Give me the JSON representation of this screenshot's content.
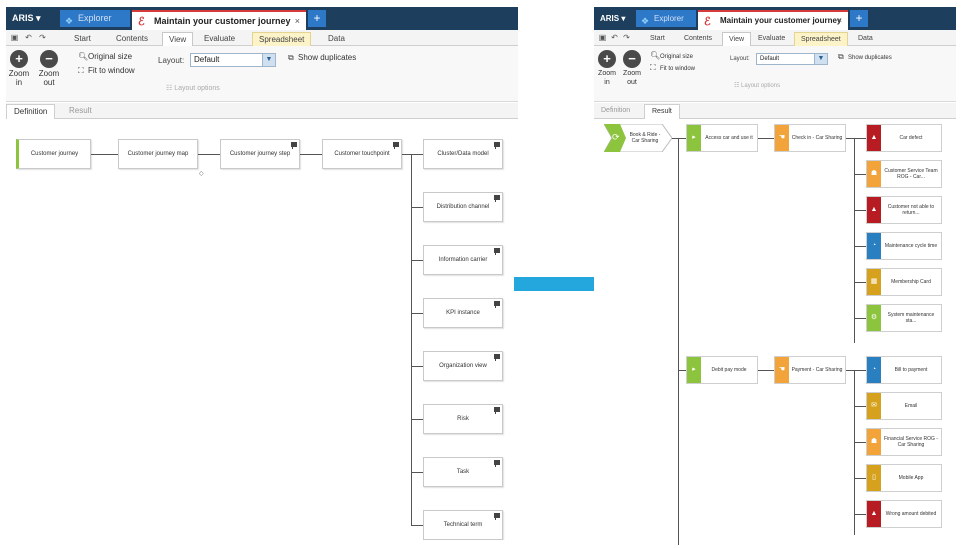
{
  "colors": {
    "titlebar": "#1d3e5c",
    "tab_blue": "#2e78c8",
    "active_red": "#d63a3a",
    "green": "#8cc43e",
    "orange": "#f2a33a",
    "dark_red": "#b81c23",
    "blue": "#2a7fc1",
    "mustard": "#d6a21e",
    "arrow": "#23a7dd"
  },
  "app": {
    "name": "ARIS",
    "explorer": "Explorer",
    "active_tab": "Maintain your customer journey",
    "close": "×",
    "add": "+"
  },
  "ribbon": {
    "tabs": [
      "Start",
      "Contents",
      "View",
      "Evaluate",
      "Spreadsheet",
      "Data"
    ],
    "zoom_in": [
      "Zoom",
      "in"
    ],
    "zoom_out": [
      "Zoom",
      "out"
    ],
    "original_size": "Original size",
    "fit_to_window": "Fit to window",
    "layout_label": "Layout:",
    "layout_value": "Default",
    "show_duplicates": "Show duplicates",
    "layout_options": "Layout options"
  },
  "subtabs": [
    "Definition",
    "Result"
  ],
  "left_diagram": {
    "row": [
      "Customer journey",
      "Customer journey map",
      "Customer journey step",
      "Customer touchpoint"
    ],
    "column": [
      "Cluster/Data model",
      "Distribution channel",
      "Information carrier",
      "KPI instance",
      "Organization view",
      "Risk",
      "Task",
      "Technical term"
    ],
    "collapse_glyph": "◇"
  },
  "right_diagram": {
    "root": "Book & Ride - Car Sharing",
    "step1": "Access car and use it",
    "step1_child": "Check in - Car Sharing",
    "step1_items": [
      {
        "label": "Car defect",
        "color": "dark_red",
        "icon": "warning-icon"
      },
      {
        "label": "Customer Service Team ROG - Car...",
        "color": "orange",
        "icon": "team-icon"
      },
      {
        "label": "Customer not able to return...",
        "color": "dark_red",
        "icon": "warning-icon"
      },
      {
        "label": "Maintenance cycle time",
        "color": "blue",
        "icon": "gauge-icon"
      },
      {
        "label": "Membership Card",
        "color": "mustard",
        "icon": "card-icon"
      },
      {
        "label": "System maintenance sta...",
        "color": "green",
        "icon": "system-icon"
      }
    ],
    "step2": "Debit pay mode",
    "step2_child": "Payment - Car Sharing",
    "step2_items": [
      {
        "label": "Bill to payment",
        "color": "blue",
        "icon": "gauge-icon"
      },
      {
        "label": "Email",
        "color": "mustard",
        "icon": "email-icon"
      },
      {
        "label": "Financial Service ROG - Car Sharing",
        "color": "orange",
        "icon": "team-icon"
      },
      {
        "label": "Mobile App",
        "color": "mustard",
        "icon": "app-icon"
      },
      {
        "label": "Wrong amount debited",
        "color": "dark_red",
        "icon": "warning-icon"
      }
    ]
  }
}
